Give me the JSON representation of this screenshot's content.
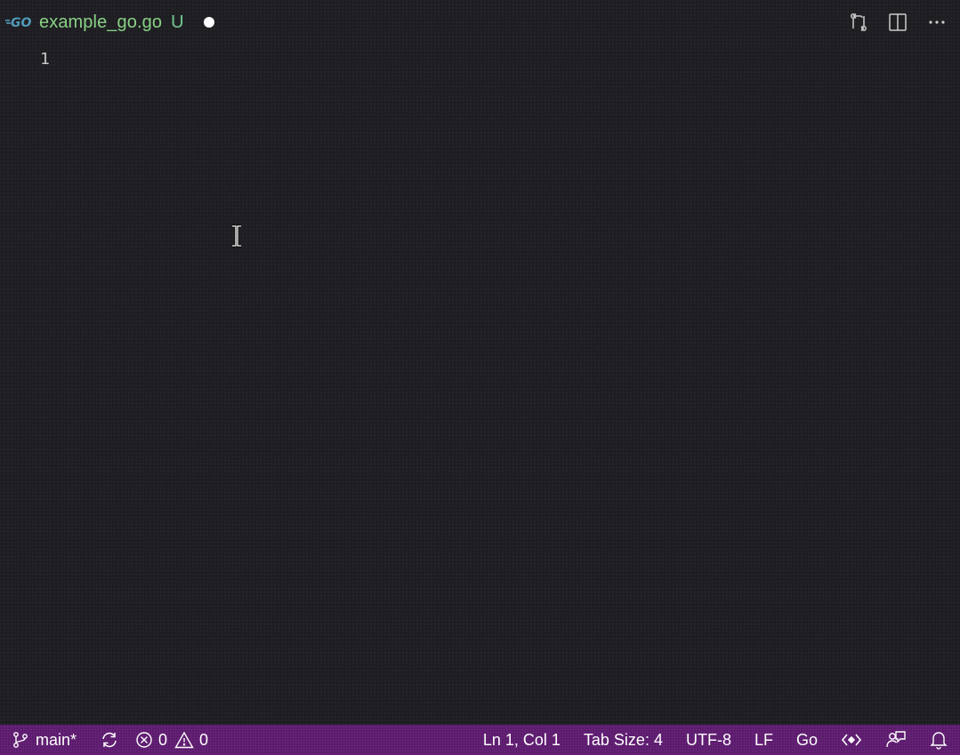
{
  "tab": {
    "icon": "go-file-icon",
    "filename": "example_go.go",
    "git_status": "U",
    "dirty": true
  },
  "editor_actions": [
    {
      "icon": "compare-changes-icon"
    },
    {
      "icon": "split-editor-icon"
    },
    {
      "icon": "more-actions-icon"
    }
  ],
  "editor": {
    "line_numbers": [
      "1"
    ]
  },
  "statusbar": {
    "branch": "main*",
    "errors": "0",
    "warnings": "0",
    "position": "Ln 1, Col 1",
    "tab_size": "Tab Size: 4",
    "encoding": "UTF-8",
    "eol": "LF",
    "language": "Go"
  },
  "colors": {
    "editor_background": "#1e1e22",
    "statusbar_background": "#68217a",
    "filename": "#89d185",
    "git_untracked": "#73c991"
  }
}
